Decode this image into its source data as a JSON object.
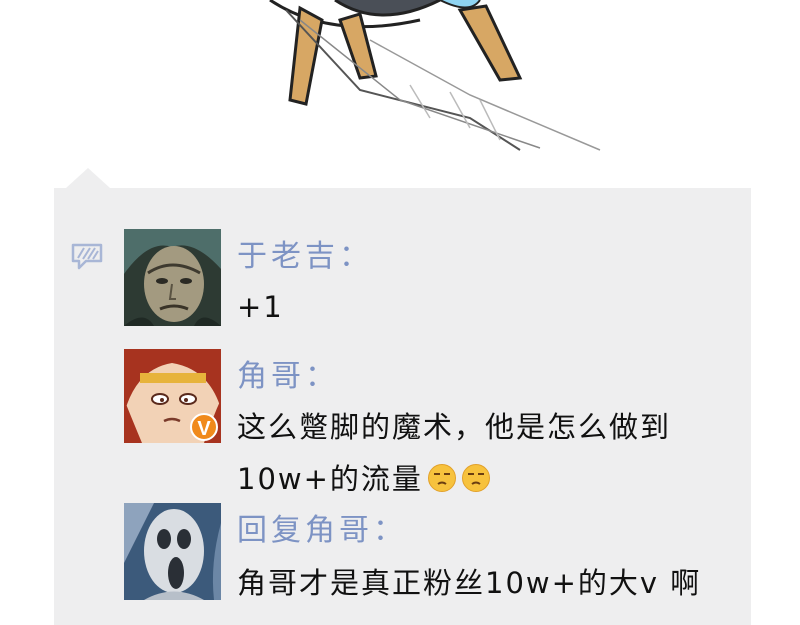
{
  "comments": [
    {
      "author": "于老吉：",
      "body": "+1"
    },
    {
      "author": "角哥：",
      "body_line1": "这么蹩脚的魔术，他是怎么做到",
      "body_line2": "10w+的流量",
      "emoji": "unamused-face-icon",
      "verified_badge": "V"
    },
    {
      "author": "回复角哥：",
      "body": "角哥才是真正粉丝10w+的大v 啊"
    }
  ],
  "colors": {
    "panel": "#eeeeef",
    "author": "#7d93c4",
    "text": "#111111",
    "badge": "#f08a1c"
  }
}
